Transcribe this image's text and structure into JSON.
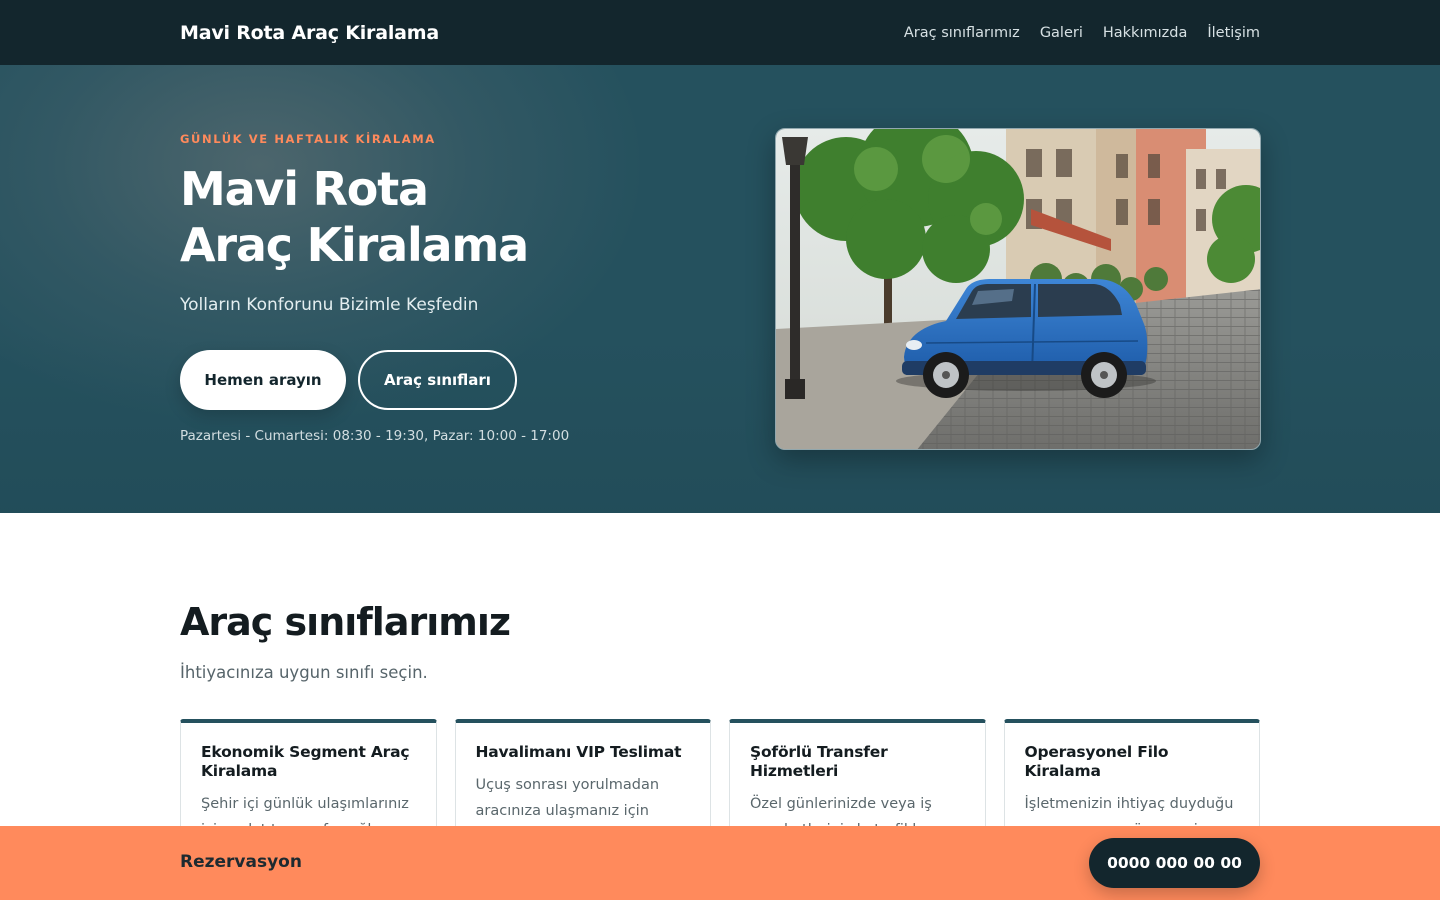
{
  "nav": {
    "brand": "Mavi Rota Araç Kiralama",
    "links": [
      "Araç sınıflarımız",
      "Galeri",
      "Hakkımızda",
      "İletişim"
    ]
  },
  "hero": {
    "eyebrow": "GÜNLÜK VE HAFTALIK KİRALAMA",
    "title_line1": "Mavi Rota",
    "title_line2": "Araç Kiralama",
    "subtitle": "Yolların Konforunu Bizimle Keşfedin",
    "call_button": "Hemen arayın",
    "classes_button": "Araç sınıfları",
    "hours": "Pazartesi - Cumartesi: 08:30 - 19:30, Pazar: 10:00 - 17:00"
  },
  "classes": {
    "title": "Araç sınıflarımız",
    "subtitle": "İhtiyacınıza uygun sınıfı seçin.",
    "cards": [
      {
        "title": "Ekonomik Segment Araç Kiralama",
        "text": "Şehir içi günlük ulaşımlarınız için yakıt tasarrufu sağlayan"
      },
      {
        "title": "Havalimanı VIP Teslimat",
        "text": "Uçuş sonrası yorulmadan aracınıza ulaşmanız için"
      },
      {
        "title": "Şoförlü Transfer Hizmetleri",
        "text": "Özel günlerinizde veya iş seyahatlerinizde trafikle"
      },
      {
        "title": "Operasyonel Filo Kiralama",
        "text": "İşletmenizin ihtiyaç duyduğu araç sayısına göre vergi"
      }
    ]
  },
  "bar": {
    "label": "Rezervasyon",
    "phone": "0000 000 00 00"
  },
  "colors": {
    "nav_bg": "#13262d",
    "hero_bg": "#25515e",
    "accent": "#ff8a5c"
  }
}
